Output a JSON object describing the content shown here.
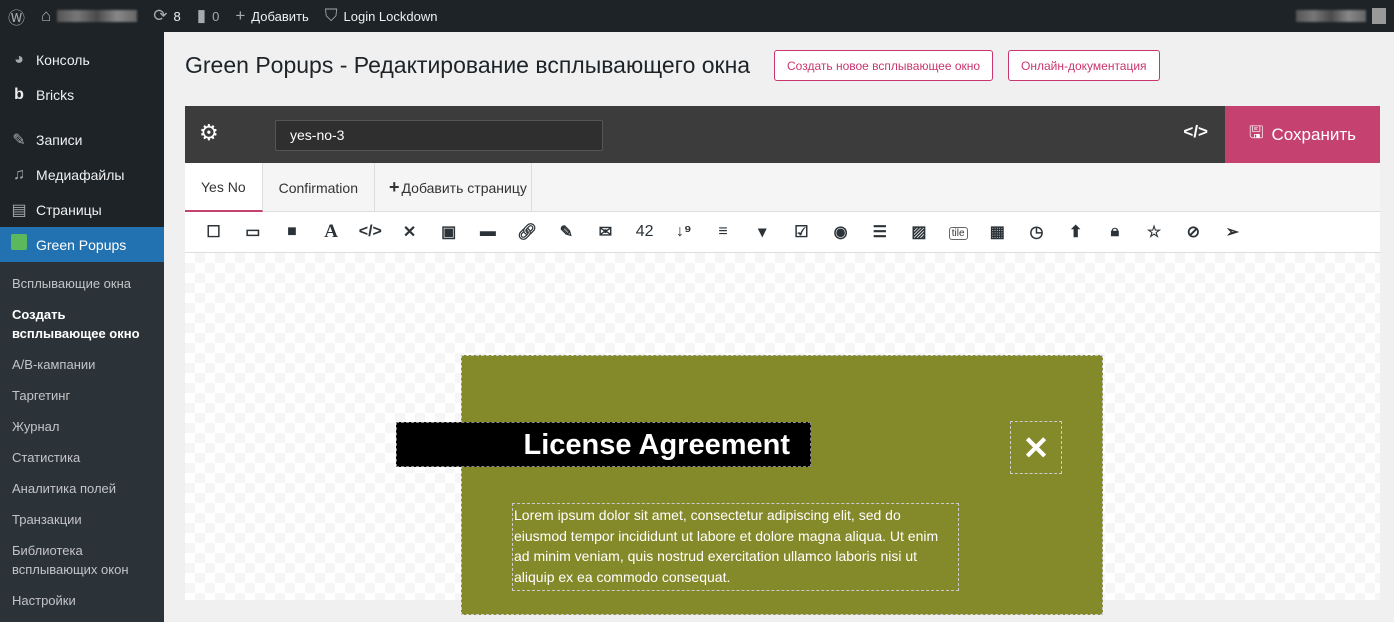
{
  "adminbar": {
    "updates": "8",
    "comments": "0",
    "add": "Добавить",
    "plugin": "Login Lockdown"
  },
  "sidebar": {
    "items": [
      {
        "label": "Консоль",
        "icon": "dashboard-icon"
      },
      {
        "label": "Bricks",
        "icon": "bricks-icon"
      },
      {
        "label": "Записи",
        "icon": "pin-icon"
      },
      {
        "label": "Медиафайлы",
        "icon": "media-icon"
      },
      {
        "label": "Страницы",
        "icon": "pages-icon"
      },
      {
        "label": "Green Popups",
        "icon": "green-popups-icon"
      }
    ],
    "submenu": [
      "Всплывающие окна",
      "Создать всплывающее окно",
      "A/B-кампании",
      "Таргетинг",
      "Журнал",
      "Статистика",
      "Аналитика полей",
      "Транзакции",
      "Библиотека всплывающих окон",
      "Настройки"
    ]
  },
  "header": {
    "title": "Green Popups - Редактирование всплывающего окна",
    "new_button": "Создать новое всплывающее окно",
    "docs_button": "Онлайн-документация"
  },
  "editor": {
    "name": "yes-no-3",
    "save": "Сохранить",
    "tabs": [
      "Yes No",
      "Confirmation"
    ],
    "add_page": "Добавить страницу",
    "tools": [
      "square",
      "image",
      "video",
      "A",
      "</>",
      "✕",
      "youtube",
      "ruler",
      "link",
      "pencil",
      "envelope",
      "42",
      "sort-numeric",
      "align-left",
      "dropdown",
      "checkbox",
      "radio",
      "list",
      "gallery",
      "tile",
      "calendar",
      "clock",
      "upload",
      "lock",
      "star",
      "eye-slash",
      "paper-plane"
    ]
  },
  "popup": {
    "bg": "#84892a",
    "title": "License Agreement",
    "close": "✕",
    "text": "Lorem ipsum dolor sit amet, consectetur adipiscing elit, sed do eiusmod tempor incididunt ut labore et dolore magna aliqua. Ut enim ad minim veniam, quis nostrud exercitation ullamco laboris nisi ut aliquip ex ea commodo consequat."
  }
}
